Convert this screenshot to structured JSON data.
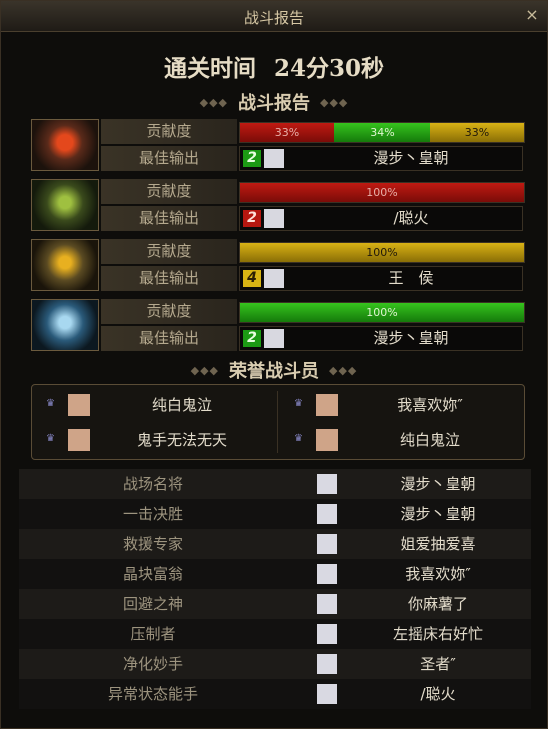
{
  "window": {
    "title": "战斗报告",
    "close_glyph": "×"
  },
  "summary": {
    "time_label": "通关时间",
    "time_value": "24分30秒"
  },
  "sections": {
    "battle_report": "战斗报告",
    "honor": "荣誉战斗员"
  },
  "row_labels": {
    "contribution": "贡献度",
    "best_output": "最佳输出"
  },
  "bosses": [
    {
      "portrait_icon": "red-demon-boss-portrait",
      "contribution": [
        {
          "label": "33%",
          "fraction": 0.33,
          "color": "red"
        },
        {
          "label": "34%",
          "fraction": 0.34,
          "color": "green"
        },
        {
          "label": "33%",
          "fraction": 0.33,
          "color": "gold"
        }
      ],
      "best": {
        "rank": "2",
        "rank_color": "green",
        "name": "漫步丶皇朝"
      }
    },
    {
      "portrait_icon": "green-demon-boss-portrait",
      "contribution": [
        {
          "label": "100%",
          "fraction": 1.0,
          "color": "red"
        }
      ],
      "best": {
        "rank": "2",
        "rank_color": "red",
        "name": "/聪火"
      }
    },
    {
      "portrait_icon": "gold-demon-boss-portrait",
      "contribution": [
        {
          "label": "100%",
          "fraction": 1.0,
          "color": "gold"
        }
      ],
      "best": {
        "rank": "4",
        "rank_color": "yellow",
        "name": "王　侯"
      }
    },
    {
      "portrait_icon": "blue-demon-boss-portrait",
      "contribution": [
        {
          "label": "100%",
          "fraction": 1.0,
          "color": "green"
        }
      ],
      "best": {
        "rank": "2",
        "rank_color": "green",
        "name": "漫步丶皇朝"
      }
    }
  ],
  "honor_members": [
    {
      "name": "纯白鬼泣"
    },
    {
      "name": "我喜欢妳″"
    },
    {
      "name": "鬼手无法无天"
    },
    {
      "name": "纯白鬼泣"
    }
  ],
  "awards": [
    {
      "title": "战场名将",
      "player": "漫步丶皇朝"
    },
    {
      "title": "一击决胜",
      "player": "漫步丶皇朝"
    },
    {
      "title": "救援专家",
      "player": "姐爱抽爱喜"
    },
    {
      "title": "晶块富翁",
      "player": "我喜欢妳″"
    },
    {
      "title": "回避之神",
      "player": "你麻薯了"
    },
    {
      "title": "压制者",
      "player": "左摇床右好忙"
    },
    {
      "title": "净化妙手",
      "player": "圣者″"
    },
    {
      "title": "异常状态能手",
      "player": "/聪火"
    }
  ]
}
